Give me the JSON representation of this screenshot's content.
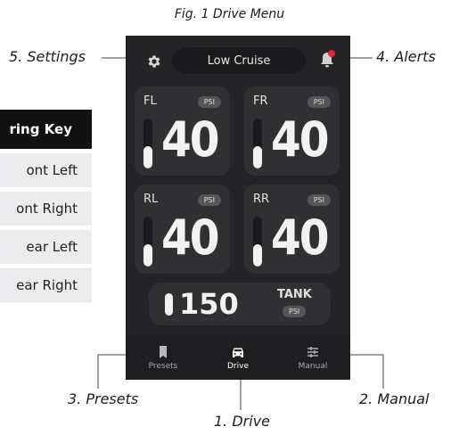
{
  "caption": "Fig. 1 Drive Menu",
  "callouts": {
    "settings": "5. Settings",
    "alerts": "4. Alerts",
    "presets": "3. Presets",
    "manual": "2. Manual",
    "drive": "1. Drive"
  },
  "key": {
    "header": "ring Key",
    "rows": [
      "ont Left",
      "ont Right",
      "ear Left",
      "ear Right"
    ]
  },
  "app": {
    "mode": "Low Cruise",
    "alert_active": true,
    "tiles": [
      {
        "corner": "FL",
        "unit": "PSI",
        "value": "40",
        "level": 0.45
      },
      {
        "corner": "FR",
        "unit": "PSI",
        "value": "40",
        "level": 0.45
      },
      {
        "corner": "RL",
        "unit": "PSI",
        "value": "40",
        "level": 0.45
      },
      {
        "corner": "RR",
        "unit": "PSI",
        "value": "40",
        "level": 0.45
      }
    ],
    "tank": {
      "value": "150",
      "label": "TANK",
      "unit": "PSI"
    },
    "nav": [
      {
        "label": "Presets",
        "icon": "bookmark-icon"
      },
      {
        "label": "Drive",
        "icon": "car-icon",
        "active": true
      },
      {
        "label": "Manual",
        "icon": "sliders-icon"
      }
    ]
  },
  "colors": {
    "phone_bg": "#242426",
    "tile_bg": "#303033",
    "alert_dot": "#e8262e",
    "text_light": "#f2f2f2"
  }
}
